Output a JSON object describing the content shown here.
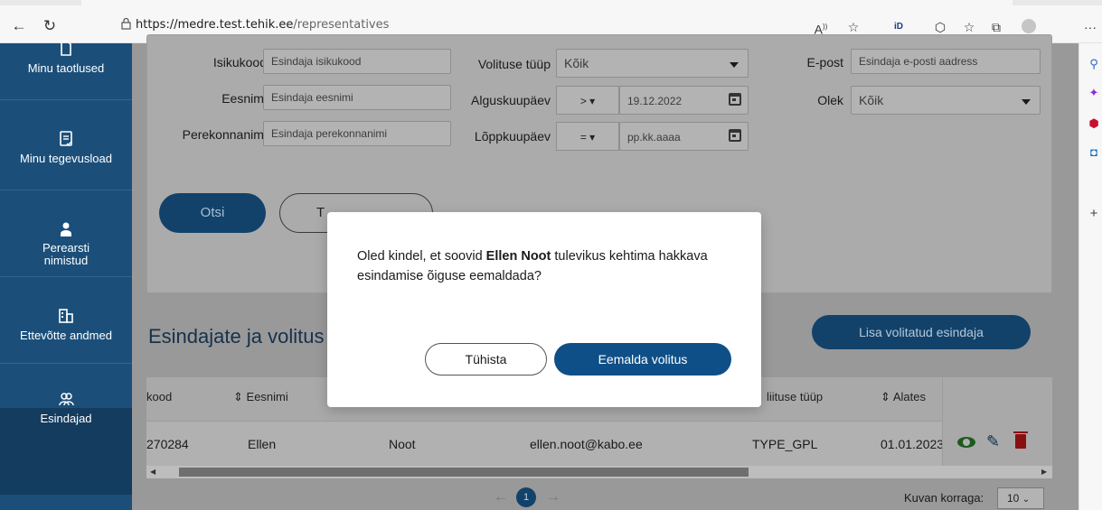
{
  "browser": {
    "url_host": "https://medre.test.tehik.ee",
    "url_path": "/representatives",
    "more": "···"
  },
  "nav": {
    "items": [
      {
        "label": "Minu taotlused"
      },
      {
        "label": "Minu tegevusload"
      },
      {
        "label": "Perearsti nimistud"
      },
      {
        "label": "Ettevõtte andmed"
      },
      {
        "label": "Esindajad"
      }
    ]
  },
  "filters": {
    "isikukood_label": "Isikukood",
    "isikukood_placeholder": "Esindaja isikukood",
    "eesnimi_label": "Eesnimi",
    "eesnimi_placeholder": "Esindaja eesnimi",
    "perekonnanimi_label": "Perekonnanimi",
    "perekonnanimi_placeholder": "Esindaja perekonnanimi",
    "volituse_tyyp_label": "Volituse tüüp",
    "volituse_tyyp_value": "Kõik",
    "alguskuupaev_label": "Alguskuupäev",
    "alguskuupaev_op": ">",
    "alguskuupaev_value": "19.12.2022",
    "loppkuupaev_label": "Lõppkuupäev",
    "loppkuupaev_op": "=",
    "loppkuupaev_placeholder": "pp.kk.aaaa",
    "epost_label": "E-post",
    "epost_placeholder": "Esindaja e-posti aadress",
    "olek_label": "Olek",
    "olek_value": "Kõik",
    "search_button": "Otsi",
    "clear_button_partial": "T"
  },
  "list": {
    "title": "Esindajate ja volitus",
    "add_button": "Lisa volitatud esindaja",
    "columns": [
      "kood",
      "Eesnimi",
      "liituse tüüp",
      "Alates"
    ],
    "rows": [
      {
        "isikukood": "270284",
        "eesnimi": "Ellen",
        "perekonnanimi": "Noot",
        "email": "ellen.noot@kabo.ee",
        "tyyp": "TYPE_GPL",
        "alates": "01.01.2023"
      }
    ],
    "pagination": {
      "current": "1"
    },
    "per_page_label": "Kuvan korraga:",
    "per_page_value": "10"
  },
  "modal": {
    "text_before": "Oled kindel, et soovid ",
    "name": "Ellen Noot",
    "text_after": " tulevikus kehtima hakkava esindamise õiguse eemaldada?",
    "cancel": "Tühista",
    "confirm": "Eemalda volitus"
  },
  "colors": {
    "nav_bg": "#1b4f7a",
    "primary": "#0f4f87"
  }
}
